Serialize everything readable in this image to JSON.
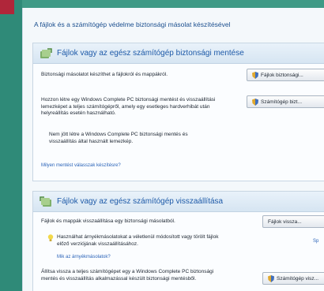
{
  "heading": "A fájlok és a számítógép védelme biztonsági másolat készítésével",
  "backup": {
    "title": "Fájlok vagy az egész számítógép biztonsági mentése",
    "files_text": "Biztonsági másolatot készíthet a fájlokról és mappákról.",
    "files_button": "Fájlok biztonsági...",
    "pc_text": "Hozzon létre egy Windows Complete PC biztonsági mentést és visszaállítási lemezképet a teljes számítógépről, amely egy esetleges hardverhibát után helyreállítás esetén használható.",
    "pc_button": "Számítógép bizt...",
    "no_backup_text": "Nem jött létre a Windows Complete PC biztonsági mentés és visszaállítás által használt lemezkép.",
    "link": "Milyen mentést válasszak készítésre?"
  },
  "restore": {
    "title": "Fájlok vagy az egész számítógép visszaállítása",
    "files_text": "Fájlok és mappák visszaállítása egy biztonsági másolatból.",
    "files_button": "Fájlok vissza...",
    "tip_text": "Használhat árnyékmásolatokat a véletlenül módosított vagy törölt fájlok előző verziójának visszaállításához.",
    "tip_link": "Mik az árnyékmásolatok?",
    "side_link": "Sp",
    "pc_text": "Állítsa vissza a teljes számítógépet egy a Windows Complete PC biztonsági mentés és visszaállítás alkalmazással készült biztonsági mentésből.",
    "pc_button": "Számítógép visz..."
  },
  "colors": {
    "accent": "#1e5aa8",
    "background": "#3f9a86",
    "brand_red": "#b0263a"
  }
}
